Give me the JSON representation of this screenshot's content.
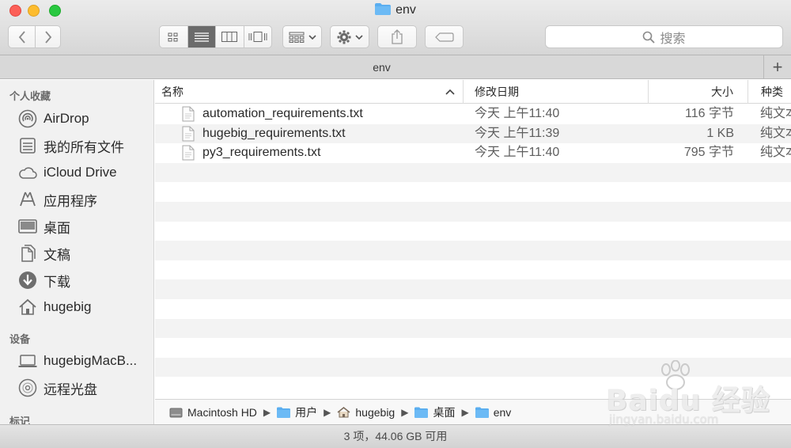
{
  "window": {
    "title": "env"
  },
  "toolbar": {
    "search_placeholder": "搜索"
  },
  "tabbar": {
    "tab_label": "env",
    "add_label": "+"
  },
  "sidebar": {
    "favorites_header": "个人收藏",
    "favorites": [
      {
        "label": "AirDrop",
        "icon": "airdrop-icon"
      },
      {
        "label": "我的所有文件",
        "icon": "all-files-icon"
      },
      {
        "label": "iCloud Drive",
        "icon": "cloud-icon"
      },
      {
        "label": "应用程序",
        "icon": "applications-icon"
      },
      {
        "label": "桌面",
        "icon": "desktop-icon"
      },
      {
        "label": "文稿",
        "icon": "documents-icon"
      },
      {
        "label": "下载",
        "icon": "download-icon"
      },
      {
        "label": "hugebig",
        "icon": "home-icon"
      }
    ],
    "devices_header": "设备",
    "devices": [
      {
        "label": "hugebigMacB...",
        "icon": "laptop-icon"
      },
      {
        "label": "远程光盘",
        "icon": "disc-icon"
      }
    ],
    "tags_header": "标记"
  },
  "list": {
    "columns": {
      "name": "名称",
      "date": "修改日期",
      "size": "大小",
      "kind": "种类"
    },
    "files": [
      {
        "name": "automation_requirements.txt",
        "date": "今天 上午11:40",
        "size": "116 字节",
        "kind": "纯文本"
      },
      {
        "name": "hugebig_requirements.txt",
        "date": "今天 上午11:39",
        "size": "1 KB",
        "kind": "纯文本"
      },
      {
        "name": "py3_requirements.txt",
        "date": "今天 上午11:40",
        "size": "795 字节",
        "kind": "纯文本"
      }
    ]
  },
  "pathbar": {
    "crumbs": [
      "Macintosh HD",
      "用户",
      "hugebig",
      "桌面",
      "env"
    ]
  },
  "statusbar": {
    "text": "3 项，44.06 GB 可用"
  },
  "watermark": {
    "main": "Baidu 经验",
    "sub": "jingyan.baidu.com"
  },
  "colors": {
    "folder_blue": "#5aaef0",
    "close": "#fc5f57",
    "minimize": "#fdbc2e",
    "maximize": "#29c840"
  }
}
